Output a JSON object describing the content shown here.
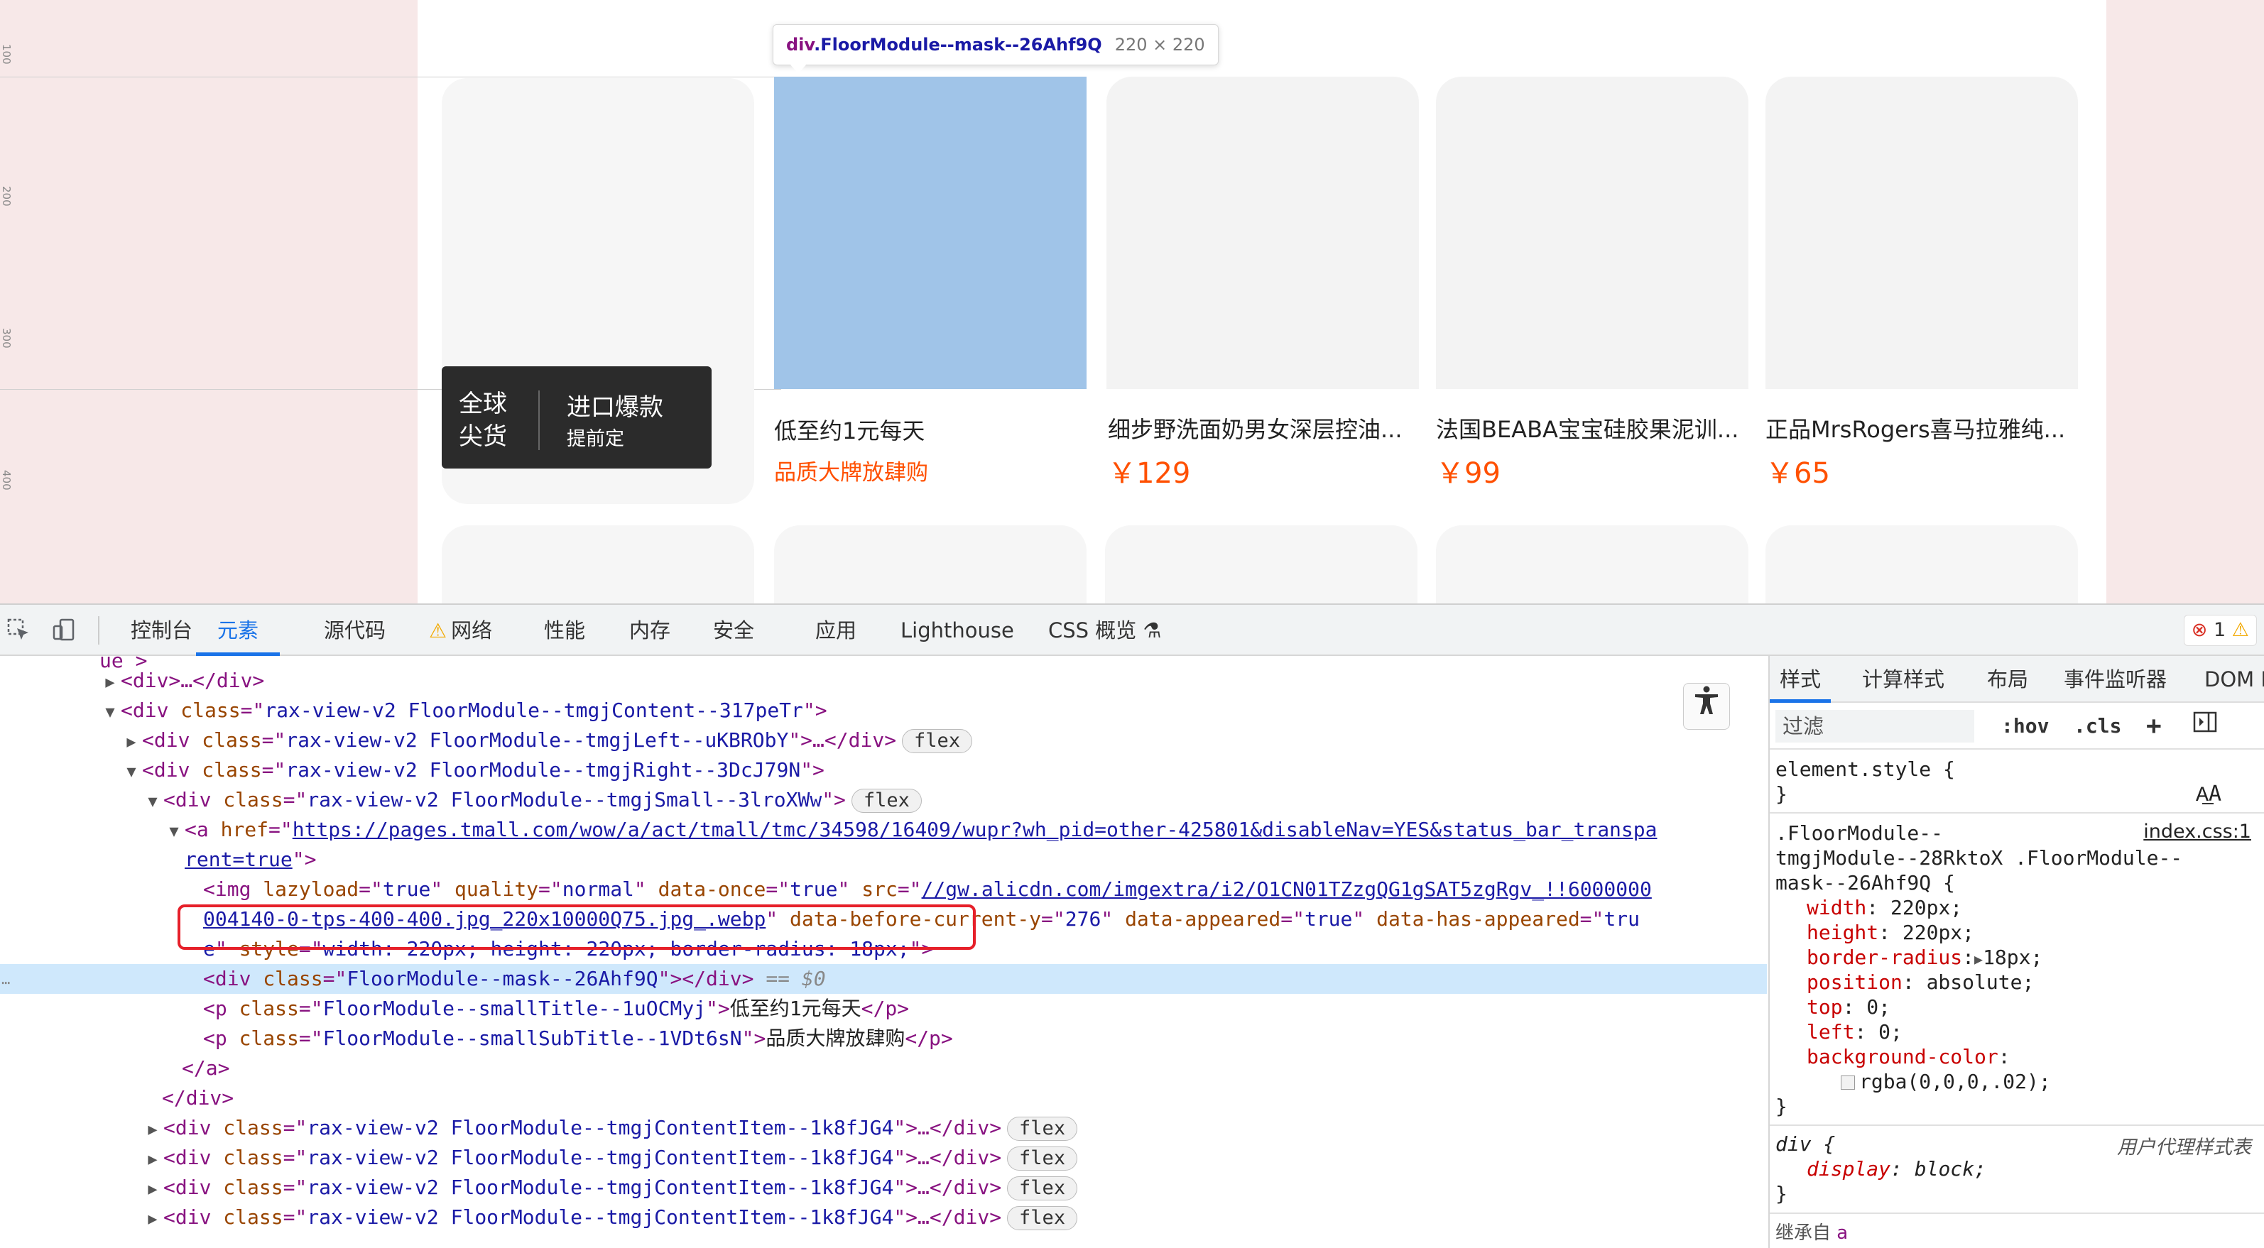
{
  "rulers": [
    "100",
    "200",
    "300",
    "400"
  ],
  "tooltip": {
    "tag": "div",
    "cls": ".FloorModule--mask--26Ahf9Q",
    "dims": "220 × 220"
  },
  "banner": {
    "left": "全球尖货",
    "title": "进口爆款",
    "sub": "提前定"
  },
  "cards": [
    {
      "title": "低至约1元每天",
      "sub": "品质大牌放肆购"
    },
    {
      "title": "细步野洗面奶男女深层控油...",
      "price": "￥129"
    },
    {
      "title": "法国BEABA宝宝硅胶果泥训...",
      "price": "￥99"
    },
    {
      "title": "正品MrsRogers喜马拉雅纯...",
      "price": "￥65"
    }
  ],
  "devtools": {
    "tabs": [
      "控制台",
      "元素",
      "源代码",
      "网络",
      "性能",
      "内存",
      "安全",
      "应用",
      "Lighthouse",
      "CSS 概览"
    ],
    "active_tab": "元素",
    "errors": "1",
    "dom": {
      "l0": "ue >",
      "l1_tag": "<div>…</div>",
      "l2_cls": "rax-view-v2 FloorModule--tmgjContent--317peTr",
      "l3_cls": "rax-view-v2 FloorModule--tmgjLeft--uKBRObY",
      "l4_cls": "rax-view-v2 FloorModule--tmgjRight--3DcJ79N",
      "l5_cls": "rax-view-v2 FloorModule--tmgjSmall--3lroXWw",
      "a_href_1": "https://pages.tmall.com/wow/a/act/tmall/tmc/34598/16409/wupr?wh_pid=other-425801&disableNav=YES&status_bar_transpa",
      "a_href_2": "rent=true",
      "img_lazy": "true",
      "img_quality": "normal",
      "img_once": "true",
      "img_src_1": "//gw.alicdn.com/imgextra/i2/O1CN01TZzgQG1gSAT5zgRgv_!!6000000",
      "img_src_2": "004140-0-tps-400-400.jpg_220x10000Q75.jpg_.webp",
      "img_before": "276",
      "img_appeared": "true",
      "img_has_appeared_1": "tru",
      "img_has_appeared_2": "e",
      "img_style": "width: 220px; height: 220px; border-radius: 18px;",
      "mask_cls": "FloorModule--mask--26Ahf9Q",
      "sel_marker": "== $0",
      "p1_cls": "FloorModule--smallTitle--1uOCMyj",
      "p1_text": "低至约1元每天",
      "p2_cls": "FloorModule--smallSubTitle--1VDt6sN",
      "p2_text": "品质大牌放肆购",
      "item_cls": "rax-view-v2 FloorModule--tmgjContentItem--1k8fJG4",
      "flex": "flex"
    },
    "styles": {
      "tabs": [
        "样式",
        "计算样式",
        "布局",
        "事件监听器",
        "DOM I"
      ],
      "filter": "过滤",
      "hov": ":hov",
      "cls": ".cls",
      "element_style": "element.style {",
      "close": "}",
      "rule_sel_1": ".FloorModule--",
      "rule_sel_2": "tmgjModule--28RktoX .FloorModule--",
      "rule_sel_3": "mask--26Ahf9Q {",
      "rule_src": "index.css:1",
      "props": [
        {
          "name": "width",
          "value": "220px;"
        },
        {
          "name": "height",
          "value": "220px;"
        },
        {
          "name": "border-radius",
          "value": "18px;"
        },
        {
          "name": "position",
          "value": "absolute;"
        },
        {
          "name": "top",
          "value": "0;"
        },
        {
          "name": "left",
          "value": "0;"
        },
        {
          "name": "background-color",
          "value": ""
        }
      ],
      "bg_value": "rgba(0,0,0,.02);",
      "ua_sel": "div {",
      "ua_label": "用户代理样式表",
      "ua_prop": "display",
      "ua_val": "block;",
      "inherit": "继承自"
    }
  },
  "colors": {
    "accent": "#1a73e8",
    "highlight": "#a0c4e8",
    "price": "#ff5000"
  }
}
